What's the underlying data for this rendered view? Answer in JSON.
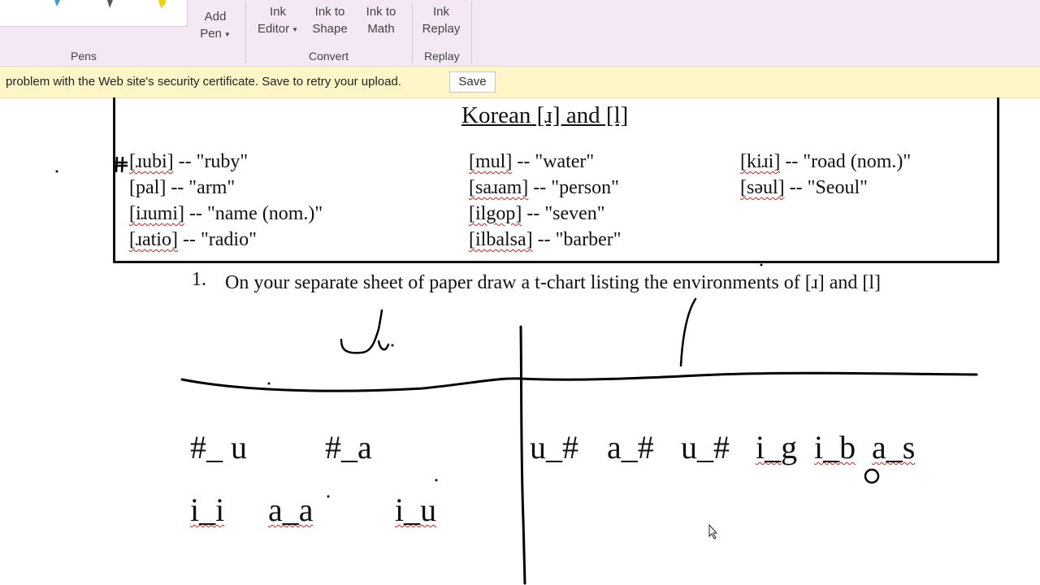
{
  "ribbon": {
    "add_pen": "Add",
    "add_pen_2": "Pen",
    "ink_editor": "Ink",
    "ink_editor_2": "Editor",
    "ink_to_shape": "Ink to",
    "ink_to_shape_2": "Shape",
    "ink_to_math": "Ink to",
    "ink_to_math_2": "Math",
    "ink_replay": "Ink",
    "ink_replay_2": "Replay",
    "groups": {
      "pens": "Pens",
      "convert": "Convert",
      "replay": "Replay"
    }
  },
  "message_bar": {
    "text": "problem with the Web site's security certificate. Save to retry your upload.",
    "save_label": "Save"
  },
  "doc": {
    "title": "Korean [ɹ] and [l]",
    "entries": [
      {
        "word": "[ɹubi]",
        "gloss": " -- \"ruby\""
      },
      {
        "word": "[pal]",
        "gloss": " -- \"arm\""
      },
      {
        "word": "[iɹumi]",
        "gloss": " -- \"name (nom.)\""
      },
      {
        "word": "[ɹatio]",
        "gloss": " -- \"radio\""
      },
      {
        "word": "[mul]",
        "gloss": " -- \"water\""
      },
      {
        "word": "[saɹam]",
        "gloss": " -- \"person\""
      },
      {
        "word": "[ilgop]",
        "gloss": " -- \"seven\""
      },
      {
        "word": "[ilbalsa]",
        "gloss": " -- \"barber\""
      },
      {
        "word": "[kiɹi]",
        "gloss": " -- \"road (nom.)\""
      },
      {
        "word": "[səul]",
        "gloss": " -- \"Seoul\""
      }
    ],
    "question_number": "1.",
    "question_text": "On your separate sheet of paper draw a t-chart listing the environments of [ɹ] and [l]"
  },
  "tchart": {
    "left": [
      "#_ u",
      "#_a",
      "i_i",
      "a_a",
      "i_u"
    ],
    "right": [
      "u_#",
      "a_#",
      "u_#",
      "i_g",
      "i_b",
      "a_s"
    ]
  },
  "colors": {
    "ink": "#000000",
    "ribbon": "#f3e8f3",
    "message_bar": "#fff6c8",
    "spell_squiggle": "#d02020"
  }
}
